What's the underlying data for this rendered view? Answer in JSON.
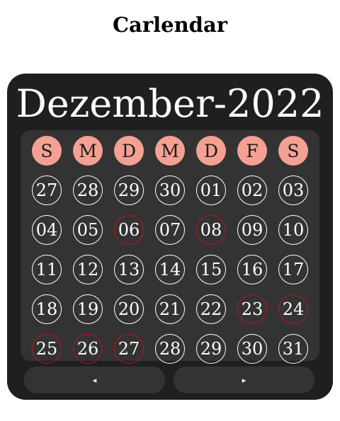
{
  "app": {
    "title": "Carlendar"
  },
  "calendar": {
    "month_title": "Dezember-2022",
    "weekdays": [
      "S",
      "M",
      "D",
      "M",
      "D",
      "F",
      "S"
    ],
    "weeks": [
      [
        {
          "day": "27",
          "marked": false
        },
        {
          "day": "28",
          "marked": false
        },
        {
          "day": "29",
          "marked": false
        },
        {
          "day": "30",
          "marked": false
        },
        {
          "day": "01",
          "marked": false
        },
        {
          "day": "02",
          "marked": false
        },
        {
          "day": "03",
          "marked": false
        }
      ],
      [
        {
          "day": "04",
          "marked": false
        },
        {
          "day": "05",
          "marked": false
        },
        {
          "day": "06",
          "marked": true
        },
        {
          "day": "07",
          "marked": false
        },
        {
          "day": "08",
          "marked": true
        },
        {
          "day": "09",
          "marked": false
        },
        {
          "day": "10",
          "marked": false
        }
      ],
      [
        {
          "day": "11",
          "marked": false
        },
        {
          "day": "12",
          "marked": false
        },
        {
          "day": "13",
          "marked": false
        },
        {
          "day": "14",
          "marked": false
        },
        {
          "day": "15",
          "marked": false
        },
        {
          "day": "16",
          "marked": false
        },
        {
          "day": "17",
          "marked": false
        }
      ],
      [
        {
          "day": "18",
          "marked": false
        },
        {
          "day": "19",
          "marked": false
        },
        {
          "day": "20",
          "marked": false
        },
        {
          "day": "21",
          "marked": false
        },
        {
          "day": "22",
          "marked": false
        },
        {
          "day": "23",
          "marked": true
        },
        {
          "day": "24",
          "marked": true
        }
      ],
      [
        {
          "day": "25",
          "marked": true
        },
        {
          "day": "26",
          "marked": true
        },
        {
          "day": "27",
          "marked": true
        },
        {
          "day": "28",
          "marked": false
        },
        {
          "day": "29",
          "marked": false
        },
        {
          "day": "30",
          "marked": false
        },
        {
          "day": "31",
          "marked": false
        }
      ]
    ],
    "nav": {
      "prev_label": "◂",
      "next_label": "▸"
    },
    "colors": {
      "weekday_bg": "#f4a093",
      "marked_border": "#c0121b",
      "panel_bg": "#1f1f1f",
      "grid_bg": "#333333"
    }
  }
}
